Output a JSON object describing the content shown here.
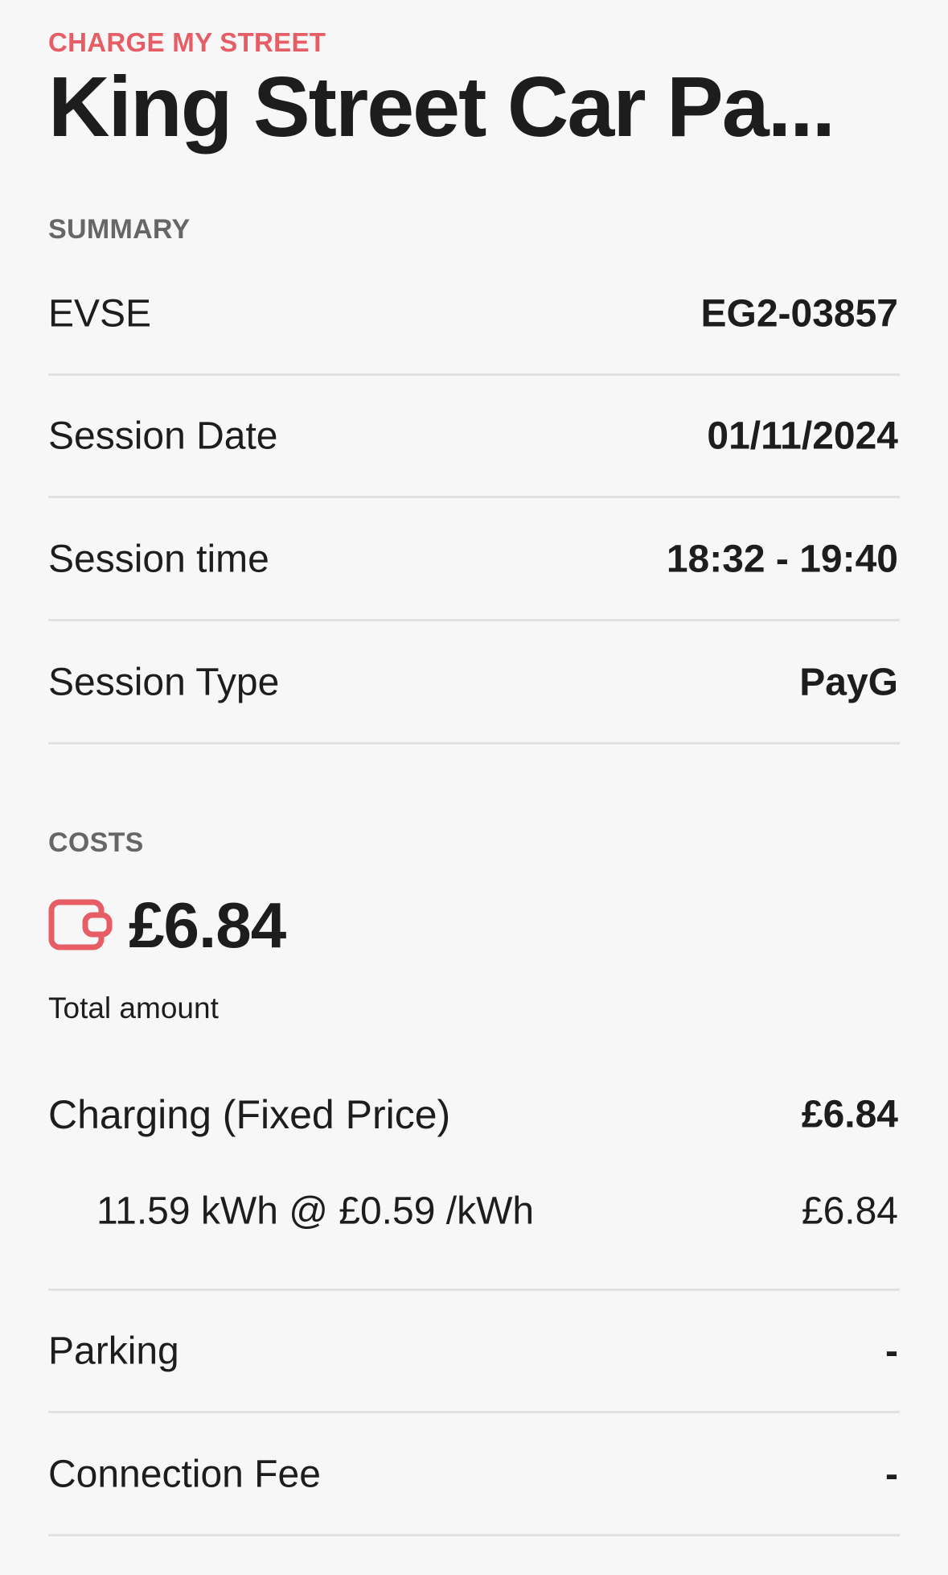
{
  "header": {
    "eyebrow": "CHARGE MY STREET",
    "title": "King Street Car Pa..."
  },
  "summary": {
    "label": "SUMMARY",
    "rows": [
      {
        "label": "EVSE",
        "value": "EG2-03857"
      },
      {
        "label": "Session Date",
        "value": "01/11/2024"
      },
      {
        "label": "Session time",
        "value": "18:32 - 19:40"
      },
      {
        "label": "Session Type",
        "value": "PayG"
      }
    ]
  },
  "costs": {
    "label": "COSTS",
    "icon": "wallet-icon",
    "total_amount": "£6.84",
    "total_label": "Total amount",
    "charging": {
      "label": "Charging (Fixed Price)",
      "value": "£6.84",
      "detail_label": "11.59 kWh @ £0.59 /kWh",
      "detail_value": "£6.84"
    },
    "rows": [
      {
        "label": "Parking",
        "value": "-"
      },
      {
        "label": "Connection Fee",
        "value": "-"
      }
    ]
  },
  "colors": {
    "accent": "#e65d66",
    "text": "#1d1d1d",
    "muted": "#666666",
    "divider": "#e1e1e1",
    "background": "#f7f7f7"
  }
}
